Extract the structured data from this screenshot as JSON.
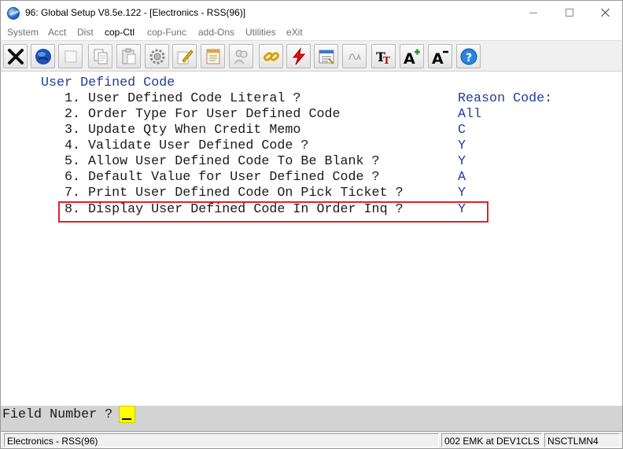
{
  "window": {
    "title": "96: Global Setup V8.5e.122 - [Electronics - RSS(96)]"
  },
  "menu": {
    "items": [
      {
        "label": "System",
        "enabled": false
      },
      {
        "label": "Acct",
        "enabled": false
      },
      {
        "label": "Dist",
        "enabled": false
      },
      {
        "label": "cop-Ctl",
        "enabled": true
      },
      {
        "label": "cop-Func",
        "enabled": false
      },
      {
        "label": "add-Ons",
        "enabled": false
      },
      {
        "label": "Utilities",
        "enabled": false
      },
      {
        "label": "eXit",
        "enabled": false
      }
    ]
  },
  "toolbar": {
    "icons": [
      "close-icon",
      "globe-icon",
      "blank-icon",
      "copy-icon",
      "paste-icon",
      "settings-icon",
      "edit-icon",
      "notepad-icon",
      "users-icon",
      "chain-icon",
      "lightning-icon",
      "calculator-icon",
      "signature-icon",
      "font-icon",
      "font-increase-icon",
      "font-decrease-icon",
      "help-icon"
    ]
  },
  "screen": {
    "title": "User Defined Code",
    "fields": [
      {
        "label": "1. User Defined Code Literal ?",
        "value": "Reason Code:"
      },
      {
        "label": "2. Order Type For User Defined Code",
        "value": "All"
      },
      {
        "label": "3. Update Qty When Credit Memo",
        "value": "C"
      },
      {
        "label": "4. Validate User Defined Code ?",
        "value": "Y"
      },
      {
        "label": "5. Allow User Defined Code To Be Blank ?",
        "value": "Y"
      },
      {
        "label": "6. Default Value for User Defined Code ?",
        "value": "A"
      },
      {
        "label": "7. Print User Defined Code On Pick Ticket ?",
        "value": "Y"
      },
      {
        "label": "8. Display User Defined Code In Order Inq ?",
        "value": "Y"
      }
    ],
    "highlight_color": "#e0202a"
  },
  "command": {
    "prompt": "Field Number ?",
    "value": ""
  },
  "status": {
    "company": "Electronics - RSS(96)",
    "user": "002 EMK at DEV1CLS",
    "program": "NSCTLMN4"
  }
}
